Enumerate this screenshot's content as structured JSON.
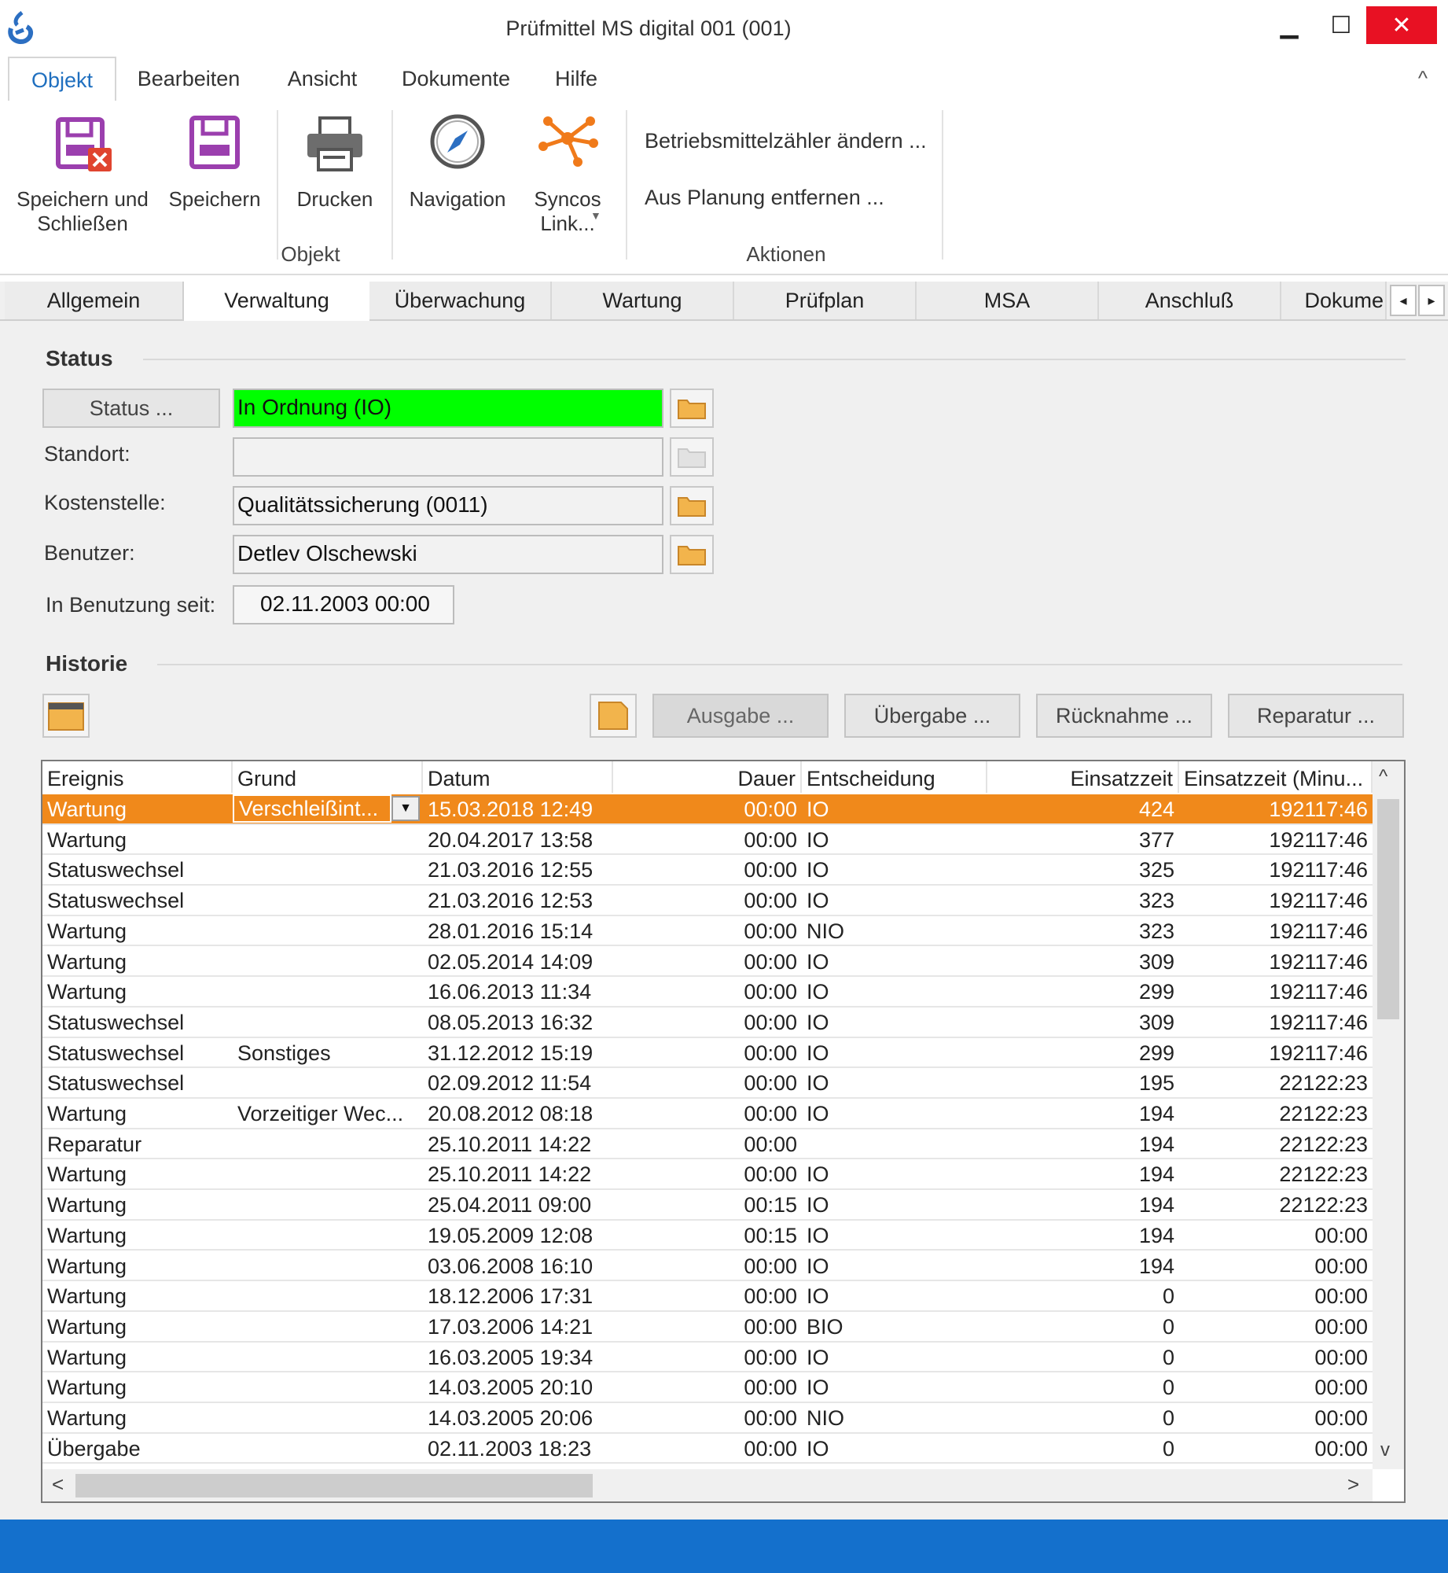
{
  "window": {
    "title": "Prüfmittel MS digital 001 (001)",
    "minimize_glyph": "▁",
    "maximize_glyph": "☐",
    "close_glyph": "✕"
  },
  "menu": {
    "tabs": [
      "Objekt",
      "Bearbeiten",
      "Ansicht",
      "Dokumente",
      "Hilfe"
    ],
    "collapse_glyph": "^"
  },
  "ribbon": {
    "save_close_line1": "Speichern und",
    "save_close_line2": "Schließen",
    "save": "Speichern",
    "print": "Drucken",
    "navigation": "Navigation",
    "syncos_line1": "Syncos",
    "syncos_line2": "Link...",
    "group_objekt": "Objekt",
    "action_counter": "Betriebsmittelzähler ändern ...",
    "action_remove": "Aus Planung entfernen ...",
    "group_aktionen": "Aktionen"
  },
  "tabs": [
    "Allgemein",
    "Verwaltung",
    "Überwachung",
    "Wartung",
    "Prüfplan",
    "MSA",
    "Anschluß",
    "Dokume"
  ],
  "tab_arrows": [
    "◂",
    "▸"
  ],
  "status_section": {
    "title": "Status",
    "status_button": "Status ...",
    "status_value": "In Ordnung (IO)",
    "status_color": "#00ff00",
    "standort_label": "Standort:",
    "standort_value": "",
    "kostenstelle_label": "Kostenstelle:",
    "kostenstelle_value": "Qualitätssicherung (0011)",
    "benutzer_label": "Benutzer:",
    "benutzer_value": "Detlev Olschewski",
    "seit_label": "In Benutzung seit:",
    "seit_value": "02.11.2003  00:00"
  },
  "historie": {
    "title": "Historie",
    "buttons": {
      "ausgabe": "Ausgabe ...",
      "uebergabe": "Übergabe ...",
      "ruecknahme": "Rücknahme ...",
      "reparatur": "Reparatur ..."
    },
    "columns": [
      "Ereignis",
      "Grund",
      "Datum",
      "Dauer",
      "Entscheidung",
      "Einsatzzeit",
      "Einsatzzeit (Minu..."
    ],
    "rows": [
      [
        "Wartung",
        "Verschleißint...",
        "15.03.2018  12:49",
        "00:00",
        "IO",
        "424",
        "192117:46"
      ],
      [
        "Wartung",
        "",
        "20.04.2017  13:58",
        "00:00",
        "IO",
        "377",
        "192117:46"
      ],
      [
        "Statuswechsel",
        "",
        "21.03.2016  12:55",
        "00:00",
        "IO",
        "325",
        "192117:46"
      ],
      [
        "Statuswechsel",
        "",
        "21.03.2016  12:53",
        "00:00",
        "IO",
        "323",
        "192117:46"
      ],
      [
        "Wartung",
        "",
        "28.01.2016  15:14",
        "00:00",
        "NIO",
        "323",
        "192117:46"
      ],
      [
        "Wartung",
        "",
        "02.05.2014  14:09",
        "00:00",
        "IO",
        "309",
        "192117:46"
      ],
      [
        "Wartung",
        "",
        "16.06.2013  11:34",
        "00:00",
        "IO",
        "299",
        "192117:46"
      ],
      [
        "Statuswechsel",
        "",
        "08.05.2013  16:32",
        "00:00",
        "IO",
        "309",
        "192117:46"
      ],
      [
        "Statuswechsel",
        "Sonstiges",
        "31.12.2012  15:19",
        "00:00",
        "IO",
        "299",
        "192117:46"
      ],
      [
        "Statuswechsel",
        "",
        "02.09.2012  11:54",
        "00:00",
        "IO",
        "195",
        "22122:23"
      ],
      [
        "Wartung",
        "Vorzeitiger Wec...",
        "20.08.2012  08:18",
        "00:00",
        "IO",
        "194",
        "22122:23"
      ],
      [
        "Reparatur",
        "",
        "25.10.2011  14:22",
        "00:00",
        "",
        "194",
        "22122:23"
      ],
      [
        "Wartung",
        "",
        "25.10.2011  14:22",
        "00:00",
        "IO",
        "194",
        "22122:23"
      ],
      [
        "Wartung",
        "",
        "25.04.2011  09:00",
        "00:15",
        "IO",
        "194",
        "22122:23"
      ],
      [
        "Wartung",
        "",
        "19.05.2009  12:08",
        "00:15",
        "IO",
        "194",
        "00:00"
      ],
      [
        "Wartung",
        "",
        "03.06.2008  16:10",
        "00:00",
        "IO",
        "194",
        "00:00"
      ],
      [
        "Wartung",
        "",
        "18.12.2006  17:31",
        "00:00",
        "IO",
        "0",
        "00:00"
      ],
      [
        "Wartung",
        "",
        "17.03.2006  14:21",
        "00:00",
        "BIO",
        "0",
        "00:00"
      ],
      [
        "Wartung",
        "",
        "16.03.2005  19:34",
        "00:00",
        "IO",
        "0",
        "00:00"
      ],
      [
        "Wartung",
        "",
        "14.03.2005  20:10",
        "00:00",
        "IO",
        "0",
        "00:00"
      ],
      [
        "Wartung",
        "",
        "14.03.2005  20:06",
        "00:00",
        "NIO",
        "0",
        "00:00"
      ],
      [
        "Übergabe",
        "",
        "02.11.2003  18:23",
        "00:00",
        "IO",
        "0",
        "00:00"
      ]
    ],
    "selected_row": 0,
    "selected_color": "#f0891b",
    "scroll_glyphs": {
      "up": "^",
      "down": "v",
      "left": "<",
      "right": ">"
    }
  },
  "colors": {
    "accent_blue": "#1470cc",
    "close_red": "#e81123",
    "folder": "#f2b44c"
  }
}
